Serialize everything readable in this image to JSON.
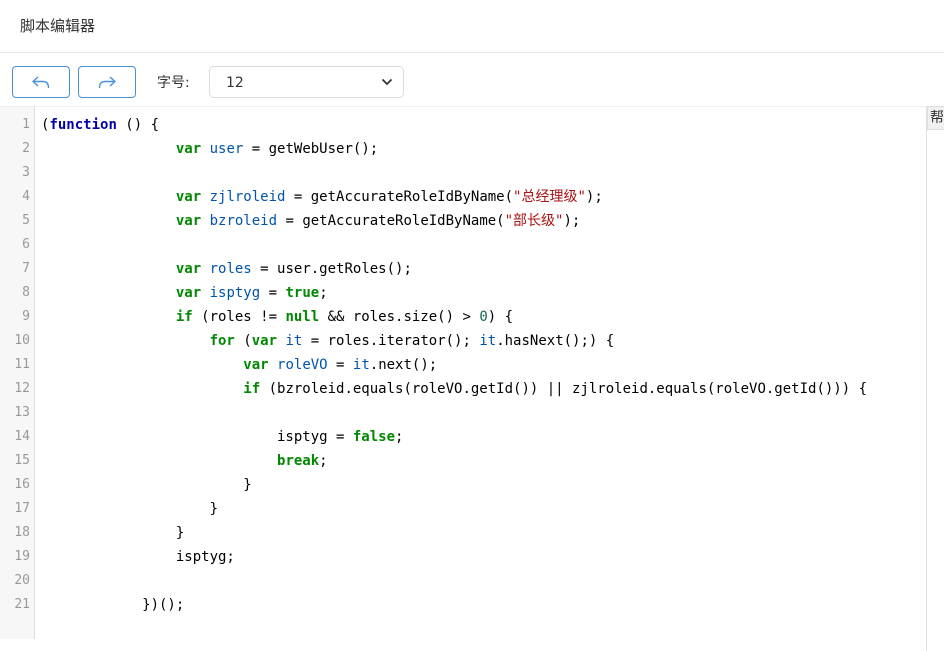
{
  "header": {
    "title": "脚本编辑器"
  },
  "toolbar": {
    "undo_icon": "undo-arrow-icon",
    "redo_icon": "redo-arrow-icon",
    "font_size_label": "字号:",
    "font_size_value": "12"
  },
  "help": {
    "label": "帮"
  },
  "editor": {
    "line_numbers": [
      "1",
      "2",
      "3",
      "4",
      "5",
      "6",
      "7",
      "8",
      "9",
      "10",
      "11",
      "12",
      "13",
      "14",
      "15",
      "16",
      "17",
      "18",
      "19",
      "20",
      "21"
    ],
    "lines": [
      "(function () {",
      "                var user = getWebUser();",
      "",
      "                var zjlroleid = getAccurateRoleIdByName(\"总经理级\");",
      "                var bzroleid = getAccurateRoleIdByName(\"部长级\");",
      "",
      "                var roles = user.getRoles();",
      "                var isptyg = true;",
      "                if (roles != null && roles.size() > 0) {",
      "                    for (var it = roles.iterator(); it.hasNext();) {",
      "                        var roleVO = it.next();",
      "                        if (bzroleid.equals(roleVO.getId()) || zjlroleid.equals(roleVO.getId())) {",
      "",
      "                            isptyg = false;",
      "                            break;",
      "                        }",
      "                    }",
      "                }",
      "                isptyg;",
      "",
      "            })();"
    ]
  },
  "colors": {
    "accent": "#4a90d9",
    "keyword": "#008800",
    "function_keyword": "#0000aa",
    "variable": "#0055aa",
    "string": "#aa1111"
  }
}
